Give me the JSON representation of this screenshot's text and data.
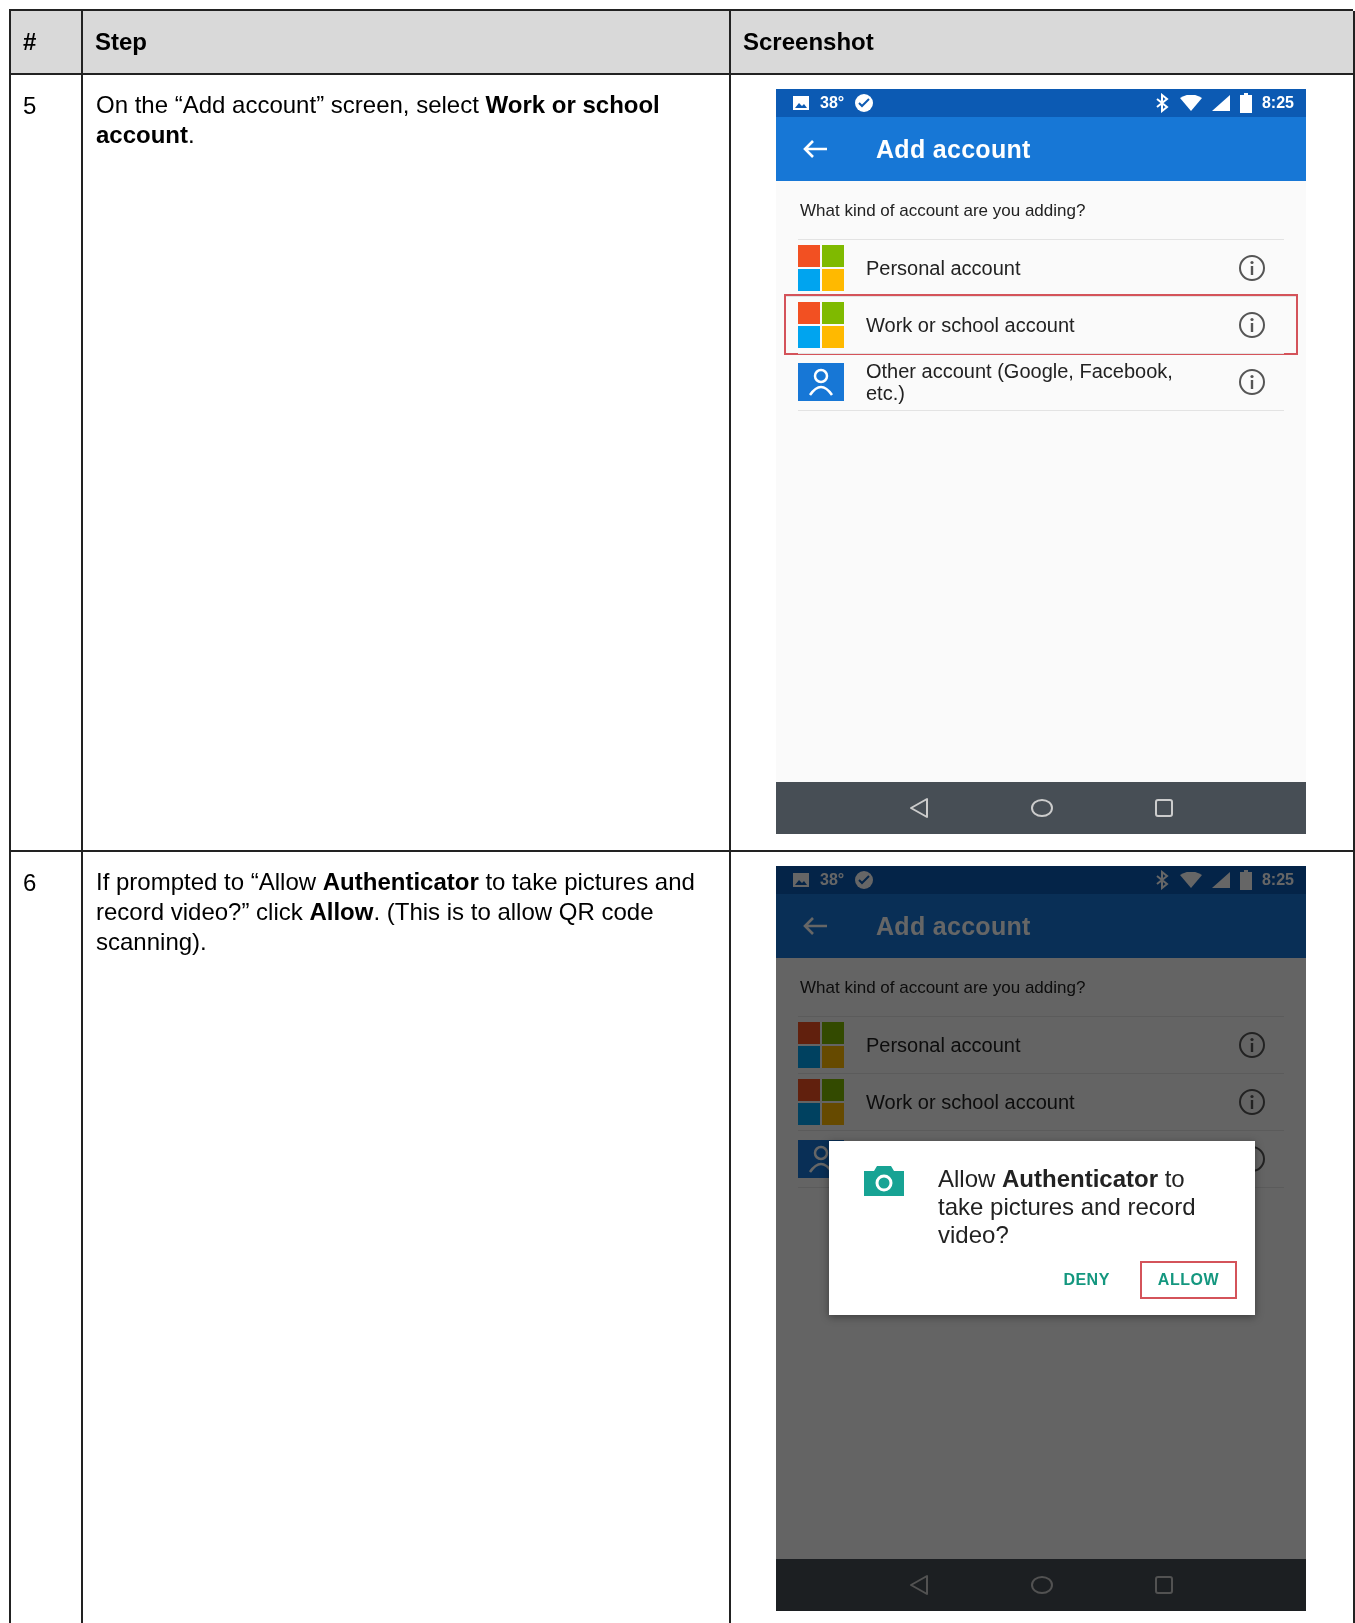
{
  "table": {
    "columns": [
      "#",
      "Step",
      "Screenshot"
    ],
    "rows": [
      {
        "number": "5",
        "step": "On the “Add account” screen, select **Work or school account**.",
        "screenshot": {
          "dimmed": false,
          "status_bar": {
            "temperature": "38°",
            "time": "8:25"
          },
          "title": "Add account",
          "prompt": "What kind of account are you adding?",
          "accounts": [
            {
              "kind": "squares",
              "label": "Personal account",
              "highlighted": false
            },
            {
              "kind": "squares",
              "label": "Work or school account",
              "highlighted": true
            },
            {
              "kind": "person",
              "label": "Other account (Google, Facebook, etc.)",
              "highlighted": false
            }
          ]
        }
      },
      {
        "number": "6",
        "step": "If prompted to “Allow **Authenticator** to take pictures and record video?” click **Allow**. (This is to allow QR code scanning).",
        "screenshot": {
          "dimmed": true,
          "status_bar": {
            "temperature": "38°",
            "time": "8:25"
          },
          "title": "Add account",
          "prompt": "What kind of account are you adding?",
          "accounts": [
            {
              "kind": "squares",
              "label": "Personal account",
              "highlighted": false
            },
            {
              "kind": "squares",
              "label": "Work or school account",
              "highlighted": false
            },
            {
              "kind": "person",
              "highlighted": false
            }
          ],
          "dialog": {
            "message": "Allow **Authenticator** to take pictures and record video?",
            "buttons": [
              {
                "label": "DENY",
                "highlighted": false
              },
              {
                "label": "ALLOW",
                "highlighted": true
              }
            ]
          }
        }
      }
    ]
  }
}
